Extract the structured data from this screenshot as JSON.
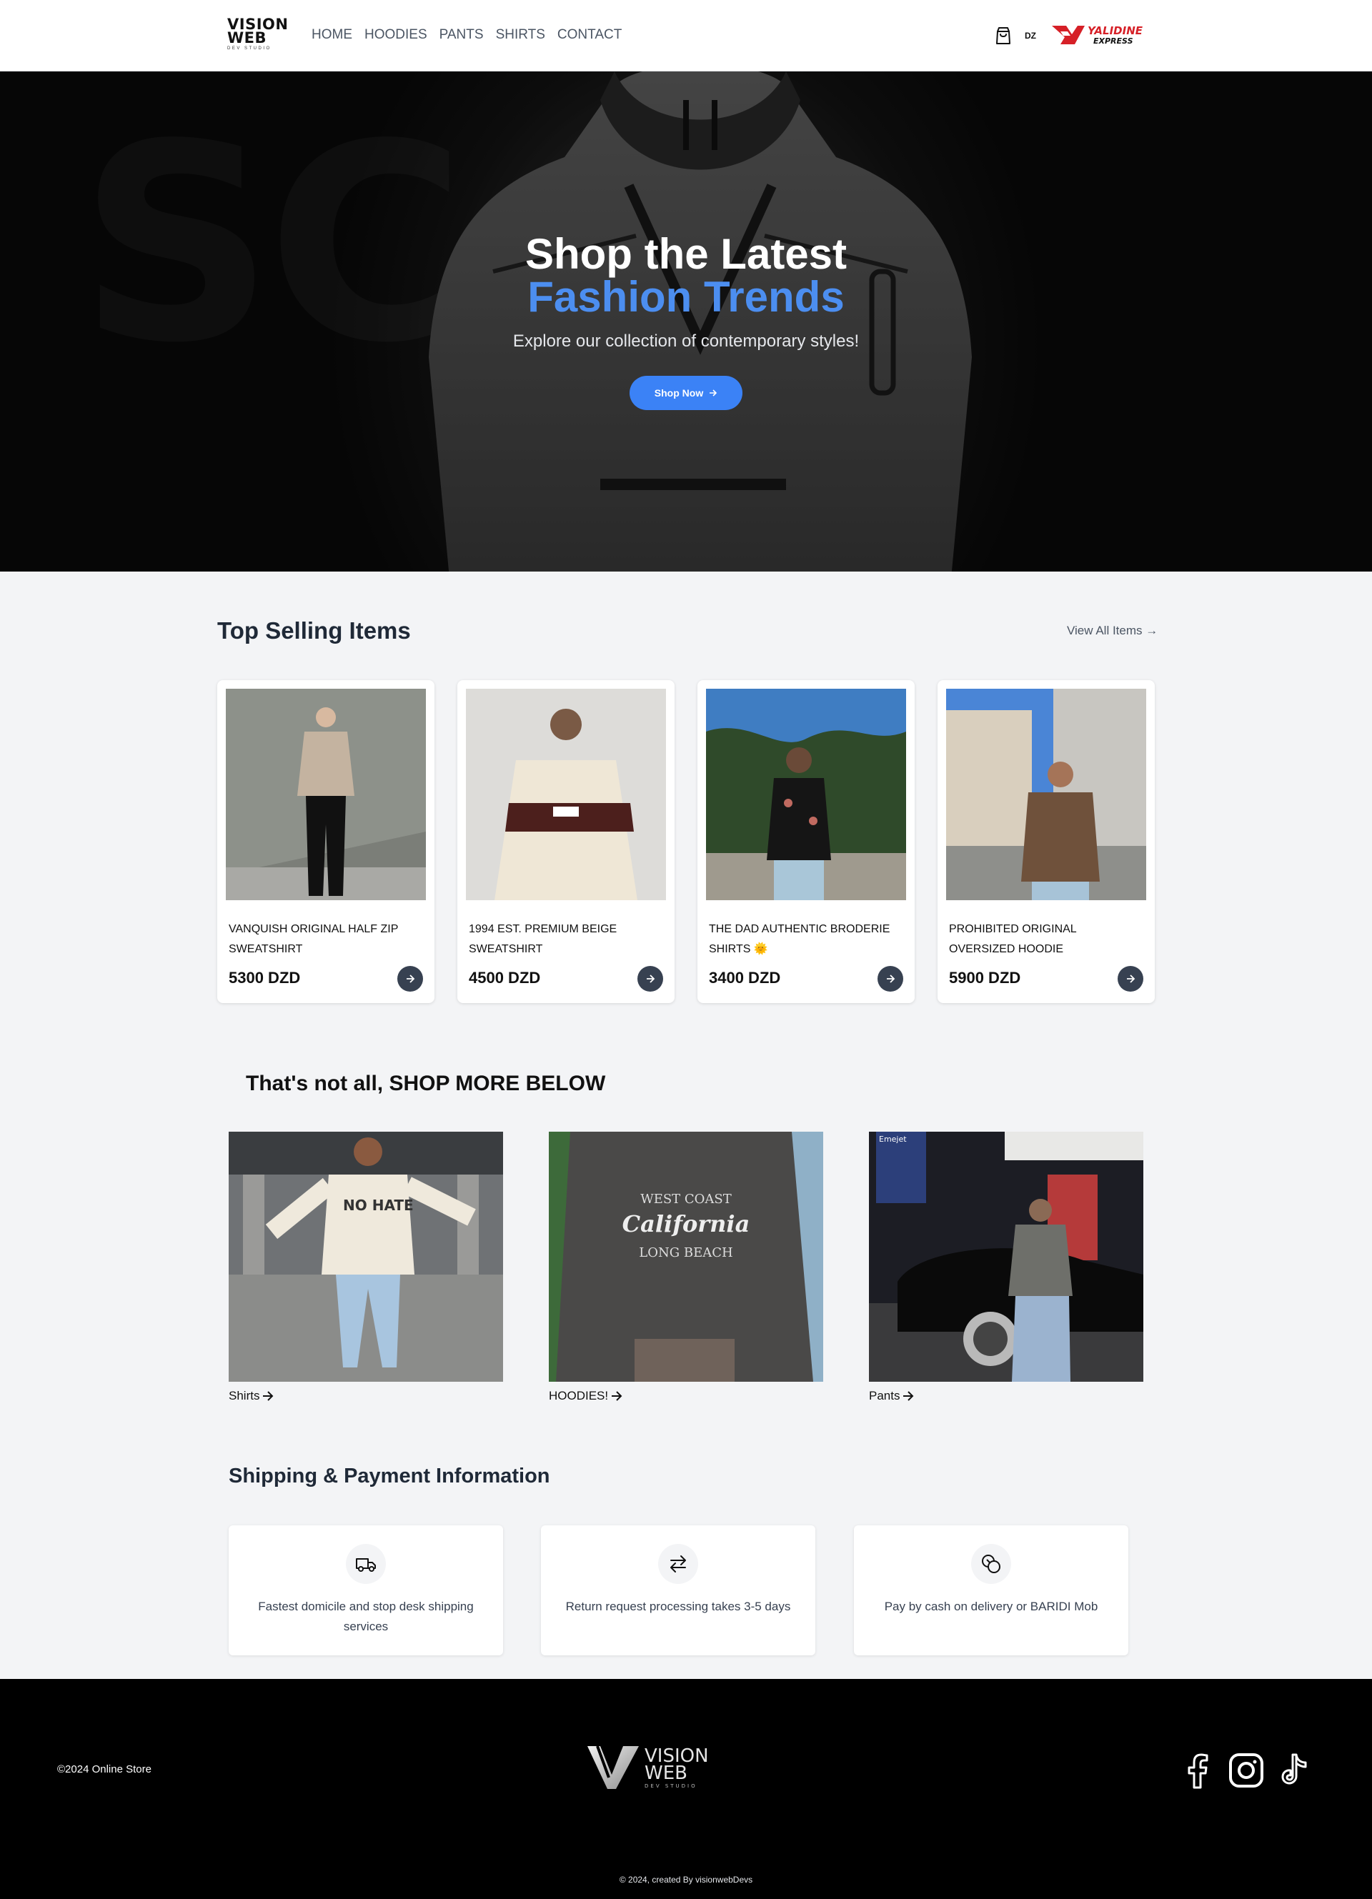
{
  "header": {
    "logo": {
      "line1": "VISION",
      "line2": "WEB",
      "line3": "DEV STUDIO"
    },
    "nav": [
      "HOME",
      "HOODIES",
      "PANTS",
      "SHIRTS",
      "CONTACT"
    ],
    "cart_icon": "shopping-bag-icon",
    "region": "DZ",
    "partner": {
      "line1": "YALIDINE",
      "line2": "EXPRESS"
    }
  },
  "hero": {
    "bg_text": "SC",
    "title_line1": "Shop the Latest",
    "title_line2": "Fashion Trends",
    "subtitle": "Explore our collection of contemporary styles!",
    "button": "Shop Now",
    "button_icon": "arrow-right-icon"
  },
  "top_selling": {
    "title": "Top Selling Items",
    "view_all": "View All Items →",
    "items": [
      {
        "name": "VANQUISH ORIGINAL HALF ZIP SWEATSHIRT",
        "price": "5300 DZD"
      },
      {
        "name": "1994 EST. PREMIUM BEIGE SWEATSHIRT",
        "price": "4500 DZD"
      },
      {
        "name": "THE DAD AUTHENTIC BRODERIE SHIRTS 🌞",
        "price": "3400 DZD"
      },
      {
        "name": "PROHIBITED ORIGINAL OVERSIZED HOODIE",
        "price": "5900 DZD"
      }
    ]
  },
  "shop_more": {
    "title": "That's not all, SHOP MORE BELOW",
    "categories": [
      {
        "label": "Shirts",
        "tee_text": "NO HATE"
      },
      {
        "label": "HOODIES!",
        "hoodie_text": [
          "WEST COAST",
          "California",
          "LONG BEACH"
        ]
      },
      {
        "label": "Pants",
        "sign_text": "Emejet"
      }
    ]
  },
  "shipping": {
    "title": "Shipping & Payment Information",
    "items": [
      {
        "icon": "truck-icon",
        "text": "Fastest domicile and stop desk shipping services"
      },
      {
        "icon": "arrows-exchange-icon",
        "text": "Return request processing takes 3-5 days"
      },
      {
        "icon": "coins-icon",
        "text": "Pay by cash on delivery or BARIDI Mob"
      }
    ]
  },
  "footer": {
    "copyright": "©2024 Online Store",
    "logo": {
      "line1": "VISION",
      "line2": "WEB",
      "line3": "DEV STUDIO"
    },
    "social": [
      "facebook-icon",
      "instagram-icon",
      "tiktok-icon"
    ],
    "credit": "© 2024, created By visionwebDevs"
  },
  "colors": {
    "accent": "#3b82f6",
    "hero_highlight": "#4c8ef0",
    "dark_button": "#374151",
    "footer_bg": "#000000"
  }
}
